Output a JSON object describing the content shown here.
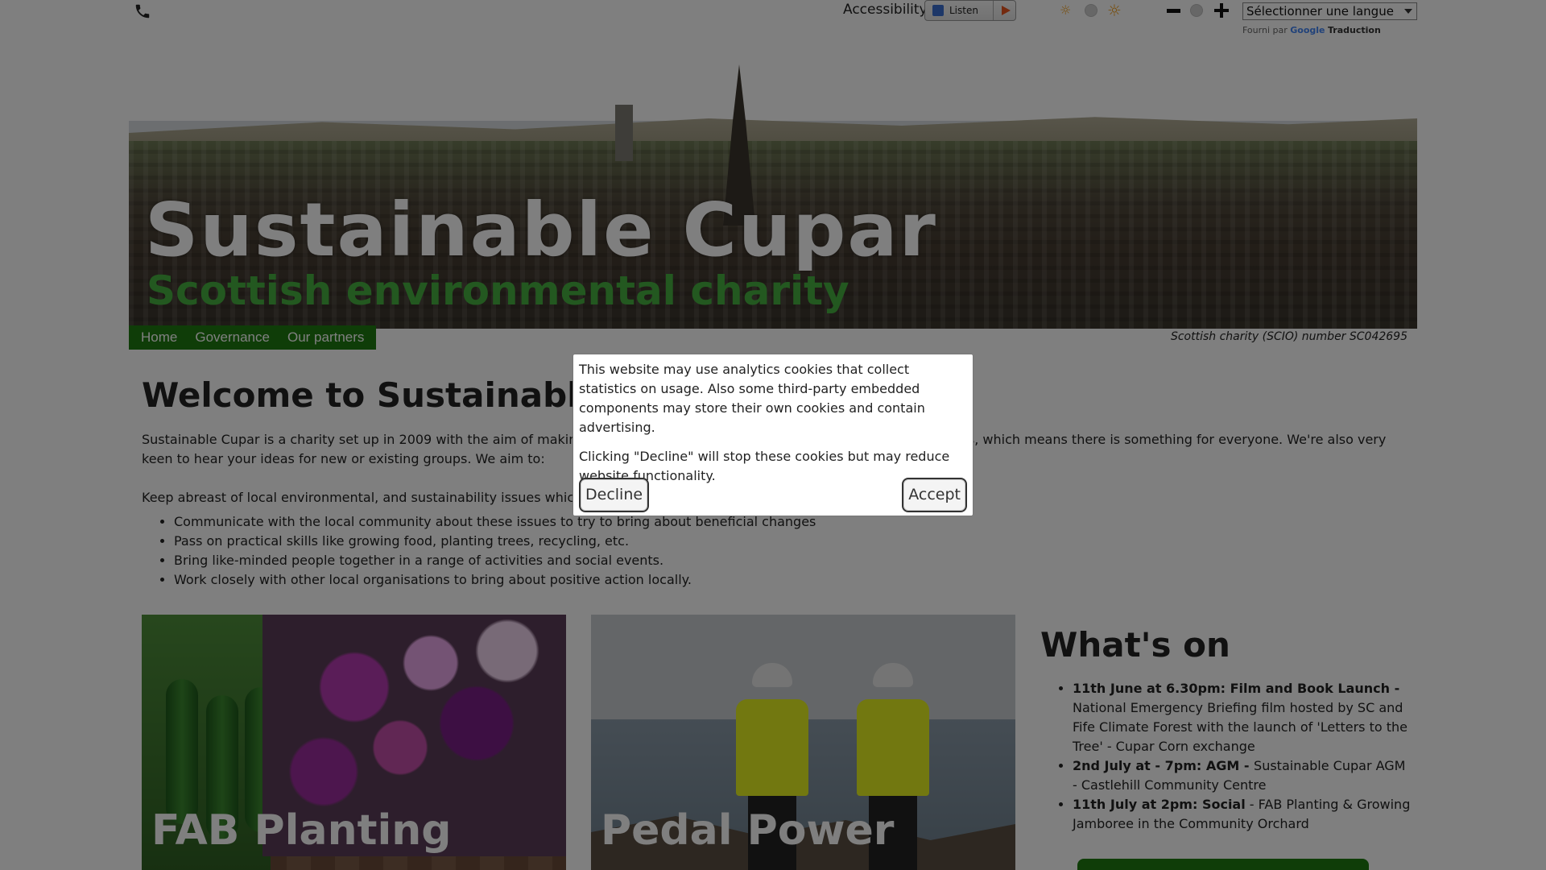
{
  "topbar": {
    "accessibility_label": "Accessibility:",
    "listen_label": "Listen",
    "language_select_value": "Sélectionner une langue",
    "powered_prefix": "Fourni par",
    "powered_brand": "Google",
    "powered_product": "Traduction"
  },
  "banner": {
    "title": "Sustainable Cupar",
    "subtitle": "Scottish environmental charity"
  },
  "nav": {
    "items": [
      "Home",
      "Governance",
      "Our partners"
    ]
  },
  "charity_number": "Scottish charity (SCIO) number SC042695",
  "main": {
    "title": "Welcome to Sustainable Cupar",
    "intro": "Sustainable Cupar is a charity set up in 2009 with the aim of making Cupar a more sustainable place. We have numerous groups, which means there is something for everyone. We're also very keen to hear your ideas for new or existing groups. We aim to:",
    "keep_abreast": "Keep abreast of local environmental, and sustainability issues which affect our community",
    "aims": [
      "Communicate with the local community about these issues to try to bring about beneficial changes",
      "Pass on practical skills like growing food, planting trees, recycling, etc.",
      "Bring like-minded people together in a range of activities and social events.",
      "Work closely with other local organisations to bring about positive action locally."
    ]
  },
  "cards": {
    "fab_title": "FAB Planting",
    "pedal_title": "Pedal Power"
  },
  "whats_on": {
    "title": "What's on",
    "events": [
      {
        "when": "11th June at 6.30pm: Film and Book Launch - ",
        "what": " National Emergency Briefing film hosted by SC and Fife Climate Forest with the launch of 'Letters to the Tree' -  Cupar Corn exchange"
      },
      {
        "when": " 2nd July at - 7pm: AGM - ",
        "what": "Sustainable Cupar AGM - Castlehill Community Centre"
      },
      {
        "when": "11th July at 2pm: Social",
        "what": " - FAB Planting & Growing Jamboree in the Community Orchard"
      }
    ]
  },
  "cookie_modal": {
    "text1": "This website may use analytics cookies that collect statistics on usage. Also some third-party embedded components may store their own cookies and contain advertising.",
    "text2": "Clicking \"Decline\" will stop these cookies but may reduce website functionality.",
    "decline_label": "Decline",
    "accept_label": "Accept"
  },
  "colors": {
    "nav_green": "#1f7a10",
    "subtitle_green": "#47b040",
    "overlay": "rgba(0,0,0,0.5)"
  },
  "icons": [
    "phone-icon",
    "speaker-icon",
    "play-icon",
    "brightness-low-icon",
    "brightness-reset-icon",
    "brightness-high-icon",
    "zoom-out-icon",
    "zoom-reset-icon",
    "zoom-in-icon"
  ]
}
